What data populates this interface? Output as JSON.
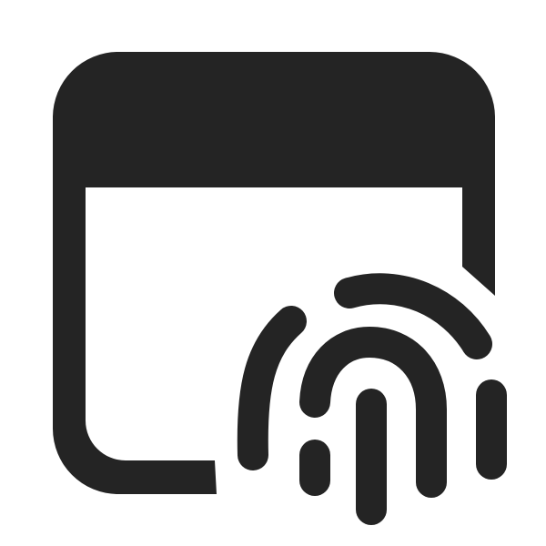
{
  "icon": {
    "name": "window-fingerprint-icon",
    "color": "#242424",
    "background": "#ffffff",
    "parts": [
      "app-window-icon",
      "fingerprint-icon"
    ]
  }
}
